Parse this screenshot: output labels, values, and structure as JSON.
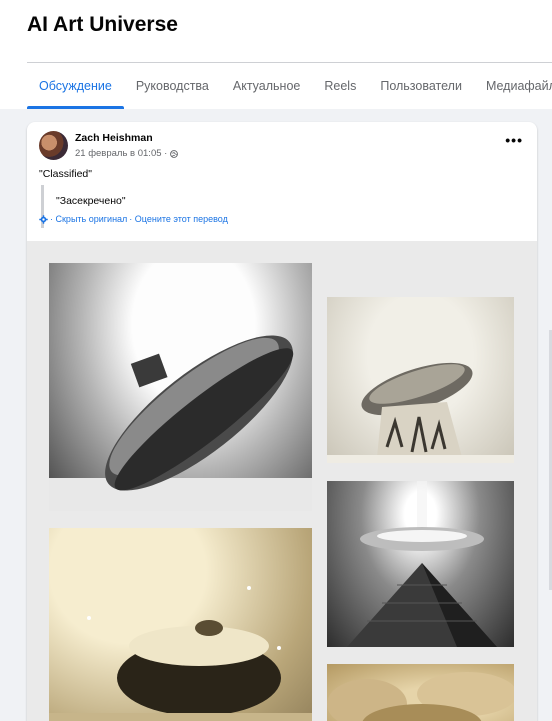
{
  "group": {
    "title": "AI Art Universe"
  },
  "tabs": [
    {
      "label": "Обсуждение",
      "active": true
    },
    {
      "label": "Руководства"
    },
    {
      "label": "Актуальное"
    },
    {
      "label": "Reels"
    },
    {
      "label": "Пользователи"
    },
    {
      "label": "Медиафайлы"
    }
  ],
  "post": {
    "author": "Zach Heishman",
    "timestamp": "21 февраль в 01:05 ·",
    "text": "\"Classified\"",
    "translation": "\"Засекречено\"",
    "hide_original": "· Скрыть оригинал",
    "rate_translation": "· Оцените этот перевод",
    "more_label": "•••"
  },
  "colors": {
    "accent": "#1b74e4",
    "background": "#f0f2f5",
    "card": "#ffffff"
  },
  "icons": {
    "privacy": "globe-icon",
    "settings": "gear-icon",
    "menu": "more-options-icon"
  }
}
